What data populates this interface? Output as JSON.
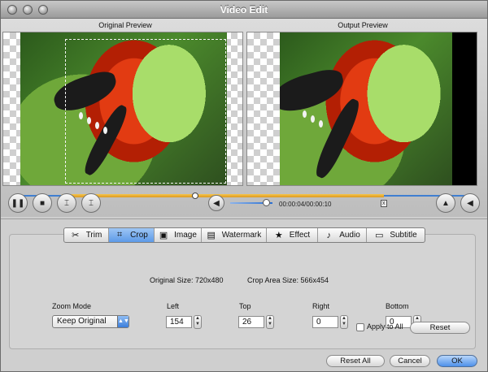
{
  "window": {
    "title": "Video Edit"
  },
  "preview": {
    "original_label": "Original Preview",
    "output_label": "Output Preview"
  },
  "playback": {
    "time": "00:00:04/00:00:10",
    "volume": 0.85,
    "position": 0.39,
    "trim_start": 0.1,
    "trim_end": 0.8
  },
  "icons": {
    "pause": "pause-icon",
    "stop": "stop-icon",
    "mark_in": "mark-in-icon",
    "mark_out": "mark-out-icon",
    "volume": "speaker-icon",
    "flip_vertical": "flip-vertical-icon",
    "flip_horizontal": "flip-horizontal-icon"
  },
  "tabs": [
    {
      "label": "Trim",
      "icon": "scissors-icon",
      "glyph": "✂"
    },
    {
      "label": "Crop",
      "icon": "crop-icon",
      "glyph": "⌗"
    },
    {
      "label": "Image",
      "icon": "image-icon",
      "glyph": "▣"
    },
    {
      "label": "Watermark",
      "icon": "watermark-icon",
      "glyph": "▤"
    },
    {
      "label": "Effect",
      "icon": "star-icon",
      "glyph": "★"
    },
    {
      "label": "Audio",
      "icon": "music-note-icon",
      "glyph": "♪"
    },
    {
      "label": "Subtitle",
      "icon": "subtitle-icon",
      "glyph": "▭"
    }
  ],
  "crop": {
    "original_size": "Original Size: 720x480",
    "crop_area_size": "Crop Area Size: 566x454",
    "zoom_mode_label": "Zoom Mode",
    "zoom_mode_value": "Keep Original",
    "left_label": "Left",
    "left_value": "154",
    "top_label": "Top",
    "top_value": "26",
    "right_label": "Right",
    "right_value": "0",
    "bottom_label": "Bottom",
    "bottom_value": "0",
    "apply_all_label": "Apply to All",
    "reset_label": "Reset"
  },
  "footer": {
    "reset_all_label": "Reset All",
    "cancel_label": "Cancel",
    "ok_label": "OK"
  },
  "colors": {
    "accent_blue": "#3f7fd1",
    "trim_orange": "#f0b33c"
  }
}
